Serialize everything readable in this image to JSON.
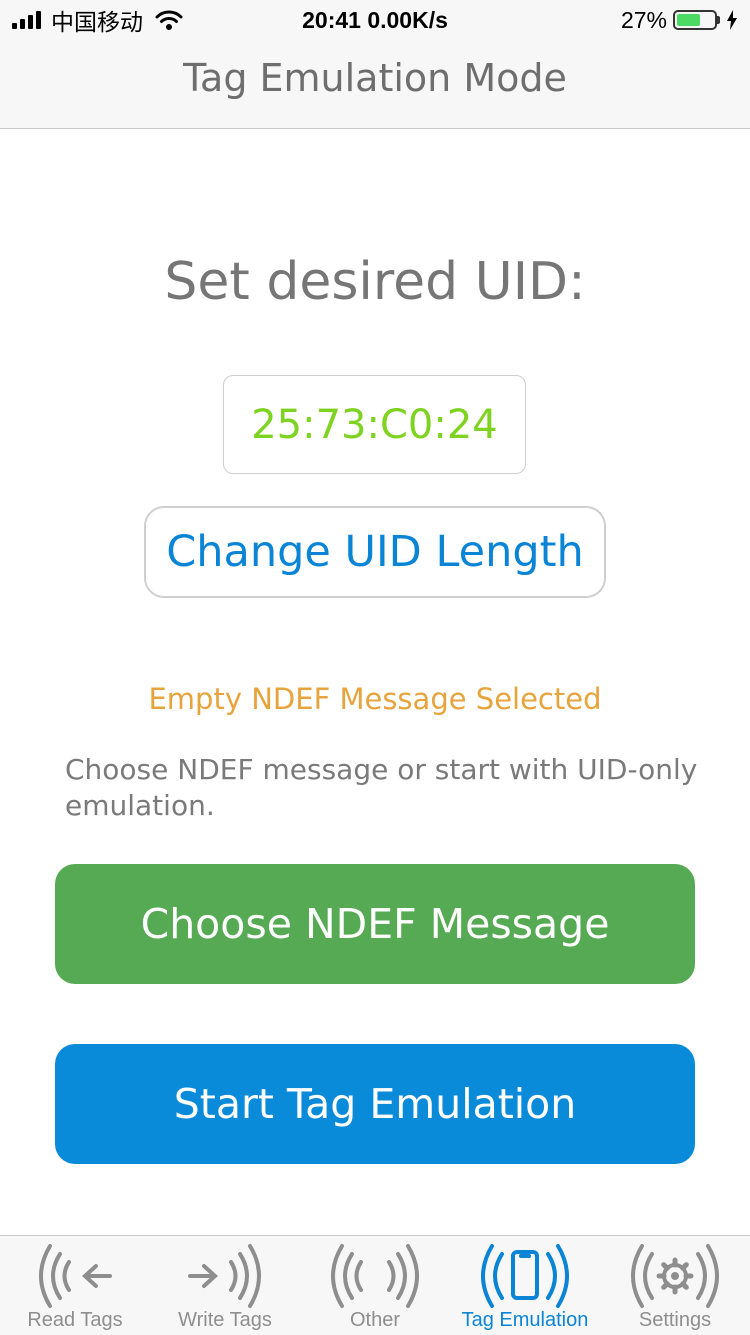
{
  "status_bar": {
    "carrier": "中国移动",
    "time": "20:41 0.00K/s",
    "battery_percent": "27%",
    "battery_level": 0.27
  },
  "nav": {
    "title": "Tag Emulation Mode"
  },
  "content": {
    "uid_heading": "Set desired UID:",
    "uid_value": "25:73:C0:24",
    "change_uid_length_label": "Change UID Length",
    "ndef_status": "Empty NDEF Message Selected",
    "hint": "Choose NDEF message or start with UID-only emulation.",
    "choose_ndef_label": "Choose NDEF Message",
    "start_emulation_label": "Start Tag Emulation"
  },
  "tabs": [
    {
      "label": "Read Tags",
      "icon": "read-tags-icon",
      "active": false
    },
    {
      "label": "Write Tags",
      "icon": "write-tags-icon",
      "active": false
    },
    {
      "label": "Other",
      "icon": "other-icon",
      "active": false
    },
    {
      "label": "Tag Emulation",
      "icon": "tag-emulation-icon",
      "active": true
    },
    {
      "label": "Settings",
      "icon": "settings-icon",
      "active": false
    }
  ],
  "colors": {
    "accent_blue": "#0a85d6",
    "green_button": "#55aa53",
    "blue_button": "#0a8bda",
    "uid_green": "#7ed321",
    "warning_orange": "#e8a43c",
    "battery_green": "#4cd964",
    "tab_inactive": "#8e8e8e"
  }
}
